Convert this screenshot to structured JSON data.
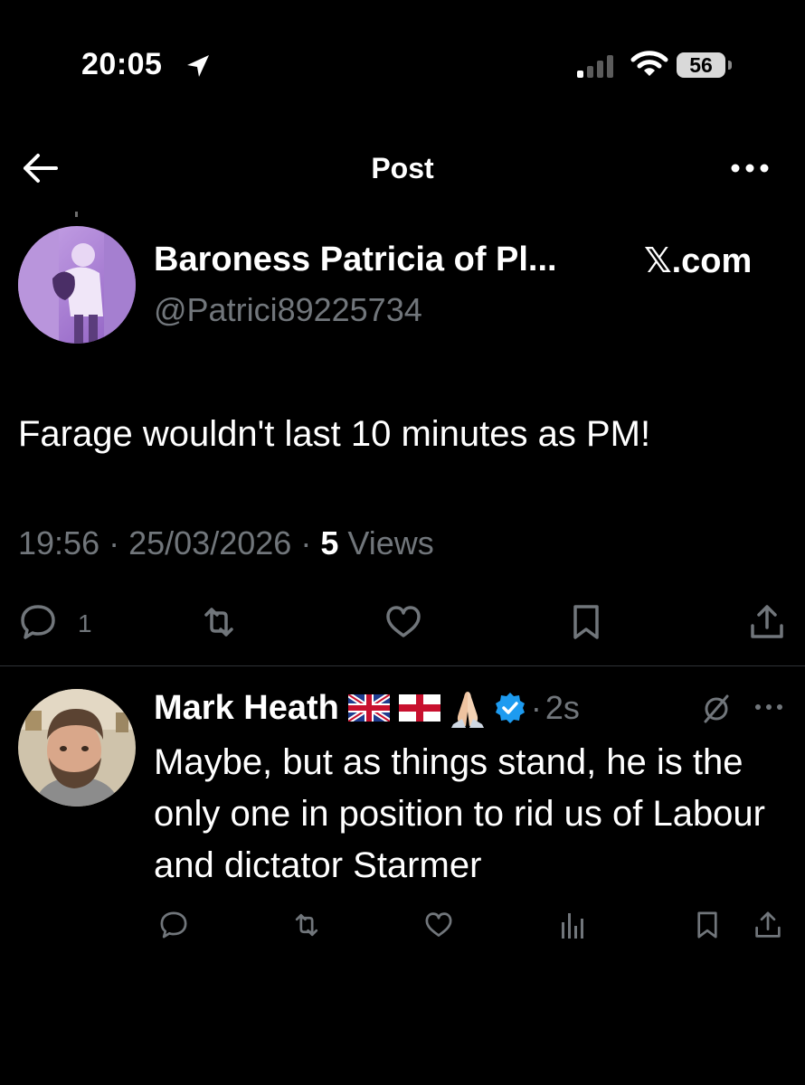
{
  "status_bar": {
    "time": "20:05",
    "battery": "56"
  },
  "header": {
    "title": "Post"
  },
  "post": {
    "author_name": "Baroness Patricia of Pl...",
    "author_handle": "@Patrici89225734",
    "source_label": "𝕏.com",
    "text": "Farage wouldn't last 10 minutes as PM!",
    "time": "19:56",
    "date": "25/03/2026",
    "views_count": "5",
    "views_label": "Views",
    "reply_count": "1"
  },
  "reply": {
    "author_name": "Mark Heath",
    "emojis": [
      "flag-uk",
      "flag-england",
      "folded-hands"
    ],
    "verified": true,
    "time": "2s",
    "text": "Maybe, but as things stand, he is the only one in position to rid us of Labour and dictator Starmer"
  },
  "colors": {
    "background": "#000000",
    "text_primary": "#ffffff",
    "text_secondary": "#71767b",
    "verified_blue": "#1d9bf0",
    "divider": "#2f3336"
  }
}
